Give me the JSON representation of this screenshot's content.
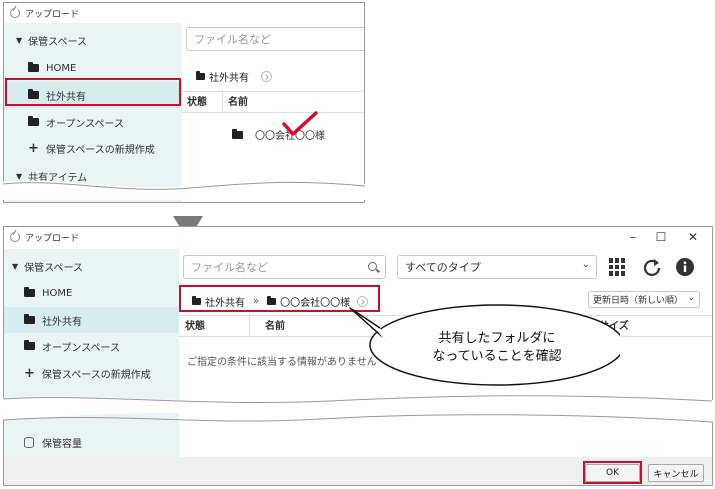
{
  "top_window": {
    "title": "アップロード",
    "sidebar": {
      "section": "保管スペース",
      "items": [
        "HOME",
        "社外共有",
        "オープンスペース"
      ],
      "create_label": "保管スペースの新規作成",
      "shared_section": "共有アイテム"
    },
    "search_placeholder": "ファイル名など",
    "breadcrumb": "社外共有",
    "columns": [
      "状態",
      "名前"
    ],
    "row": {
      "name": "〇〇会社〇〇様"
    }
  },
  "bottom_window": {
    "title": "アップロード",
    "sidebar": {
      "section": "保管スペース",
      "items": [
        "HOME",
        "社外共有",
        "オープンスペース"
      ],
      "create_label": "保管スペースの新規作成",
      "storage_label": "保管容量"
    },
    "search_placeholder": "ファイル名など",
    "type_select": "すべてのタイプ",
    "breadcrumb": [
      "社外共有",
      "〇〇会社〇〇様"
    ],
    "crumb_sep": "»",
    "sort_select": "更新日時（新しい順）",
    "columns": [
      "状態",
      "名前",
      "サイズ"
    ],
    "empty_message": "ご指定の条件に該当する情報がありません",
    "ok_label": "OK",
    "cancel_label": "キャンセル",
    "controls": {
      "minimize": "–",
      "maximize": "☐",
      "close": "✕"
    }
  },
  "callout": {
    "line1": "共有したフォルダに",
    "line2": "なっていることを確認"
  },
  "colors": {
    "highlight": "#c8102e",
    "sidebar_bg": "#e9f4f4",
    "check": "#d0112b"
  }
}
